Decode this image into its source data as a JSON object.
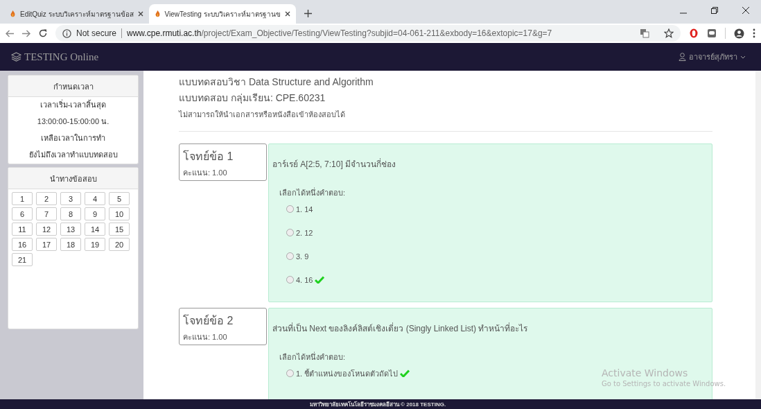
{
  "browser": {
    "tabs": [
      {
        "title": "EditQuiz ระบบวิเคราะห์มาตรฐานข้อส",
        "selected": false
      },
      {
        "title": "ViewTesting ระบบวิเคราะห์มาตรฐานข",
        "selected": true
      }
    ],
    "security": "Not secure",
    "url_host": "www.cpe.rmuti.ac.th",
    "url_path": "/project/Exam_Objective/Testing/ViewTesting?subjid=04-061-211&exbody=16&extopic=17&g=7"
  },
  "navbar": {
    "brand": "TESTING Online",
    "user": "อาจารย์สุภัทรา"
  },
  "sidebar": {
    "time_panel": {
      "title": "กำหนดเวลา",
      "lines": [
        "เวลาเริ่ม-เวลาสิ้นสุด",
        "13:00:00-15:00:00 น.",
        "เหลือเวลาในการทำ",
        "ยังไม่ถึงเวลาทำแบบทดสอบ"
      ]
    },
    "nav_panel": {
      "title": "นำทางข้อสอบ",
      "numbers": [
        "1",
        "2",
        "3",
        "4",
        "5",
        "6",
        "7",
        "8",
        "9",
        "10",
        "11",
        "12",
        "13",
        "14",
        "15",
        "16",
        "17",
        "18",
        "19",
        "20",
        "21"
      ]
    }
  },
  "exam": {
    "subject": "แบบทดสอบวิชา Data Structure and Algorithm",
    "group": "แบบทดสอบ กลุ่มเรียน: CPE.60231",
    "note": "ไม่สามารถให้นำเอกสารหรือหนังสือเข้าห้องสอบได้",
    "questions": [
      {
        "label": "โจทย์ข้อ 1",
        "score": "คะแนน: 1.00",
        "text": "อาร์เรย์ A[2:5, 7:10] มีจำนวนกี่ช่อง",
        "prompt": "เลือกได้หนึ่งคำตอบ:",
        "options": [
          {
            "text": "1. 14",
            "selected": false,
            "correct": false
          },
          {
            "text": "2. 12",
            "selected": false,
            "correct": false
          },
          {
            "text": "3. 9",
            "selected": false,
            "correct": false
          },
          {
            "text": "4. 16",
            "selected": false,
            "correct": true
          }
        ]
      },
      {
        "label": "โจทย์ข้อ 2",
        "score": "คะแนน: 1.00",
        "text": "ส่วนที่เป็น Next ของลิงค์ลิสต์เชิงเดี่ยว (Singly Linked List) ทำหน้าที่อะไร",
        "prompt": "เลือกได้หนึ่งคำตอบ:",
        "options": [
          {
            "text": "1. ชี้ตำแหน่งของโหนดตัวถัดไป",
            "selected": false,
            "correct": true
          }
        ]
      }
    ]
  },
  "footer": "มหาวิทยาลัยเทคโนโลยีราชมงคลอีสาน © 2018 TESTING.",
  "os_notice": {
    "title": "Activate Windows",
    "text": "Go to Settings to activate Windows."
  }
}
